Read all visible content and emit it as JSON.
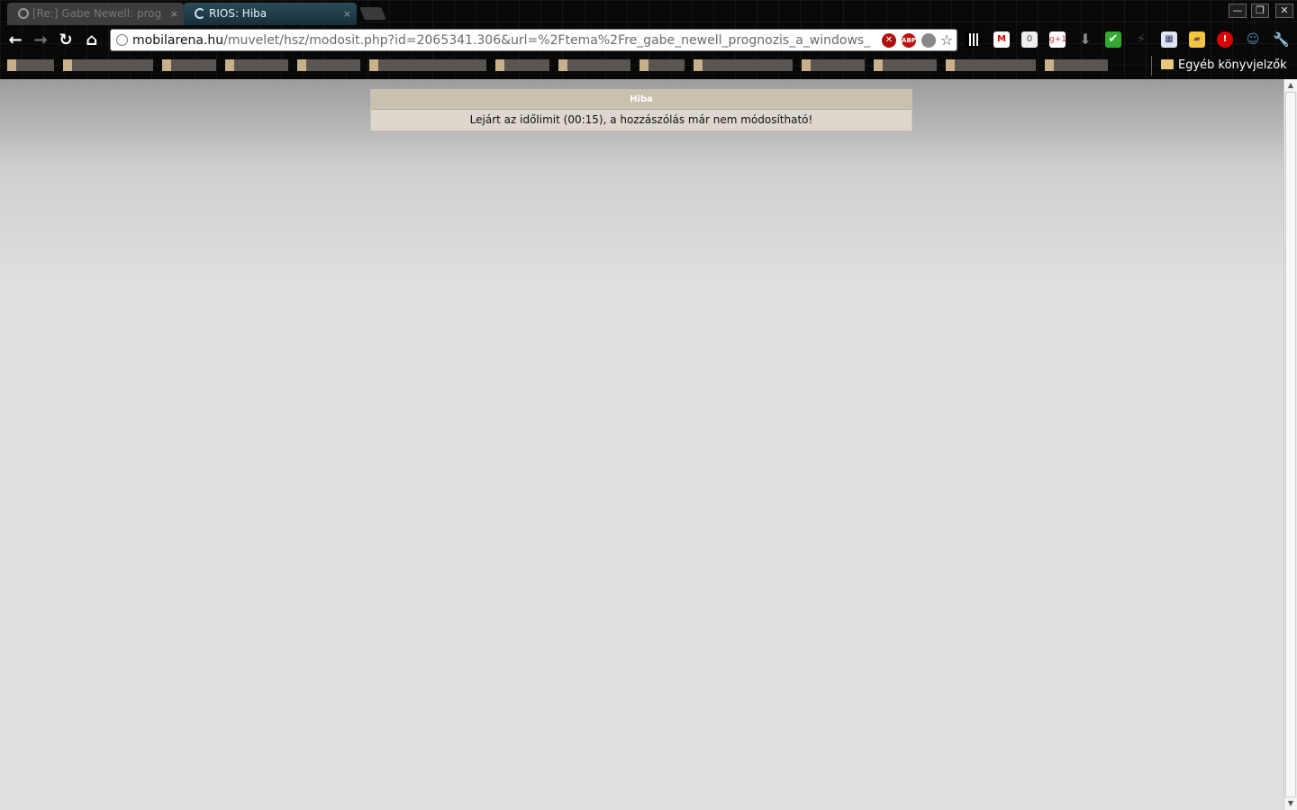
{
  "browser": {
    "tabs": [
      {
        "title": "[Re:] Gabe Newell: prog",
        "close": "×"
      },
      {
        "title": "RIOS: Hiba",
        "close": "×"
      }
    ],
    "window_controls": {
      "minimize": "—",
      "maximize": "❐",
      "close": "✕"
    },
    "nav": {
      "back": "←",
      "forward": "→",
      "reload": "↻",
      "home": "⌂"
    },
    "omnibox": {
      "host": "mobilarena.hu",
      "path": "/muvelet/hsz/modosit.php?id=2065341.306&url=%2Ftema%2Fre_gabe_newell_prognozis_a_windows_"
    },
    "omni_icons": {
      "stop": "✕",
      "abp": "ABP",
      "bulb": "",
      "star": "☆"
    },
    "extensions": {
      "gmail": "M",
      "count": "0",
      "gplus": "g+1",
      "download": "⬇",
      "check": "✔",
      "bolt": "⚡",
      "calendar": "▦",
      "folder": "▰",
      "alert": "!",
      "ghost": "☺",
      "wrench": "🔧"
    },
    "bookmarks_other": "Egyéb könyvjelzők"
  },
  "page": {
    "error_title": "Hiba",
    "error_message": "Lejárt az időlimit (00:15), a hozzászólás már nem módosítható!"
  },
  "scrollbar": {
    "up": "▲",
    "down": "▼"
  },
  "colors": {
    "tab_active": "#1f3e49",
    "error_header": "#c9c0ad",
    "error_body": "#ddd7cd",
    "page_background": "#e0e0e0"
  }
}
